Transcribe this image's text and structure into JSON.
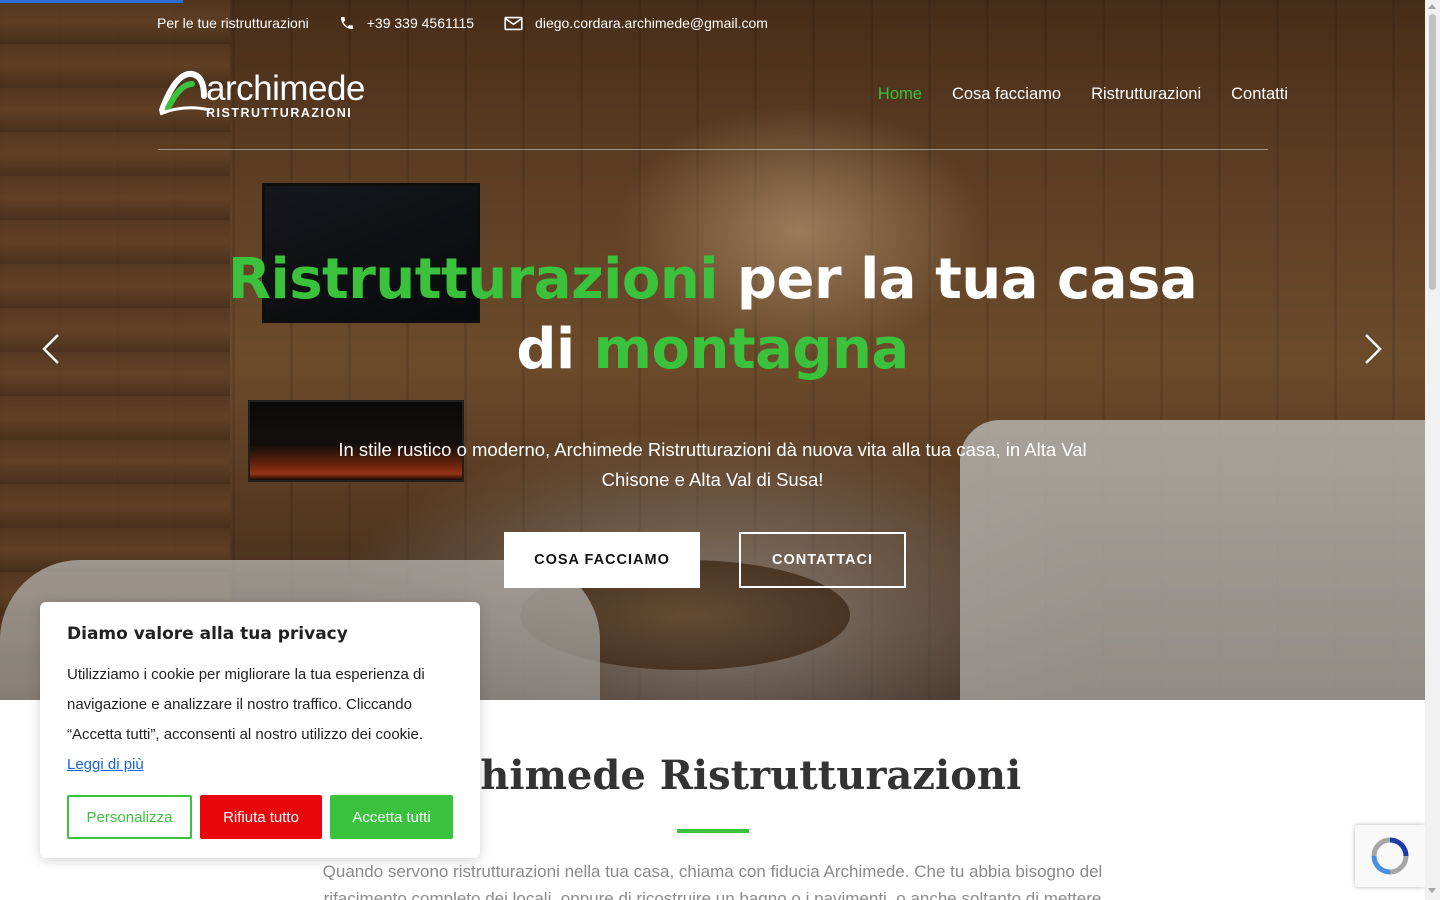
{
  "topbar": {
    "tagline": "Per le tue ristrutturazioni",
    "phone": "+39 339 4561115",
    "email": "diego.cordara.archimede@gmail.com"
  },
  "logo": {
    "name": "archimede",
    "subtitle": "RISTRUTTURAZIONI"
  },
  "nav": {
    "items": [
      {
        "label": "Home",
        "active": true
      },
      {
        "label": "Cosa facciamo",
        "active": false
      },
      {
        "label": "Ristrutturazioni",
        "active": false
      },
      {
        "label": "Contatti",
        "active": false
      }
    ]
  },
  "hero": {
    "title_part1": "Ristrutturazioni",
    "title_part2": " per la tua casa",
    "title_part3": "di ",
    "title_part4": "montagna",
    "subtitle": "In stile rustico o moderno, Archimede Ristrutturazioni dà nuova vita alla tua casa, in Alta Val Chisone e Alta Val di Susa!",
    "primary_button": "COSA FACCIAMO",
    "secondary_button": "CONTATTACI"
  },
  "section": {
    "title": "Archimede Ristrutturazioni",
    "text": "Quando servono ristrutturazioni nella tua casa, chiama con fiducia Archimede. Che tu abbia bisogno del rifacimento completo dei locali, oppure di ricostruire un bagno o i pavimenti, o anche soltanto di mettere"
  },
  "cookie": {
    "title": "Diamo valore alla tua privacy",
    "text": "Utilizziamo i cookie per migliorare la tua esperienza di navigazione e analizzare il nostro traffico. Cliccando “Accetta tutti”, acconsenti al nostro utilizzo dei cookie.",
    "link": "Leggi di più",
    "customize": "Personalizza",
    "reject": "Rifiuta tutto",
    "accept": "Accetta tutti"
  },
  "colors": {
    "accent": "#3ac23d",
    "reject": "#e8060b",
    "link": "#1863dc"
  },
  "icons": [
    "phone-icon",
    "mail-icon",
    "chevron-left-icon",
    "chevron-right-icon",
    "recaptcha-icon"
  ]
}
